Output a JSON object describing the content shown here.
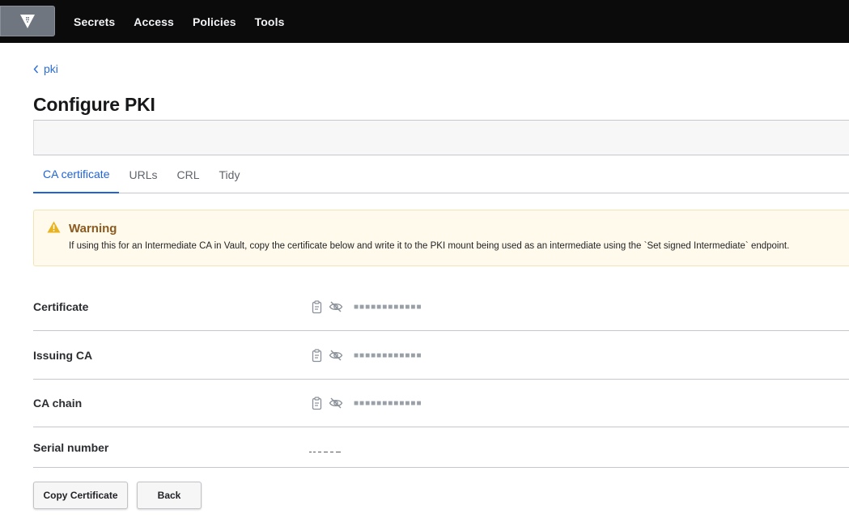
{
  "nav": {
    "items": [
      {
        "label": "Secrets"
      },
      {
        "label": "Access"
      },
      {
        "label": "Policies"
      },
      {
        "label": "Tools"
      }
    ]
  },
  "breadcrumb": {
    "label": "pki"
  },
  "page": {
    "title": "Configure PKI"
  },
  "tabs": [
    {
      "label": "CA certificate",
      "active": true
    },
    {
      "label": "URLs",
      "active": false
    },
    {
      "label": "CRL",
      "active": false
    },
    {
      "label": "Tidy",
      "active": false
    }
  ],
  "warning": {
    "title": "Warning",
    "text": "If using this for an Intermediate CA in Vault, copy the certificate below and write it to the PKI mount being used as an intermediate using the `Set signed Intermediate` endpoint."
  },
  "fields": [
    {
      "label": "Certificate",
      "masked": "■■■■■■■■■■■■"
    },
    {
      "label": "Issuing CA",
      "masked": "■■■■■■■■■■■■"
    },
    {
      "label": "CA chain",
      "masked": "■■■■■■■■■■■■"
    },
    {
      "label": "Serial number"
    }
  ],
  "buttons": {
    "copy_label": "Copy Certificate",
    "back_label": "Back"
  },
  "colors": {
    "accent": "#1f63d6",
    "topbar": "#0b0b0c",
    "warning_bg": "#fffaeb",
    "warning_title": "#8a5a1f"
  }
}
